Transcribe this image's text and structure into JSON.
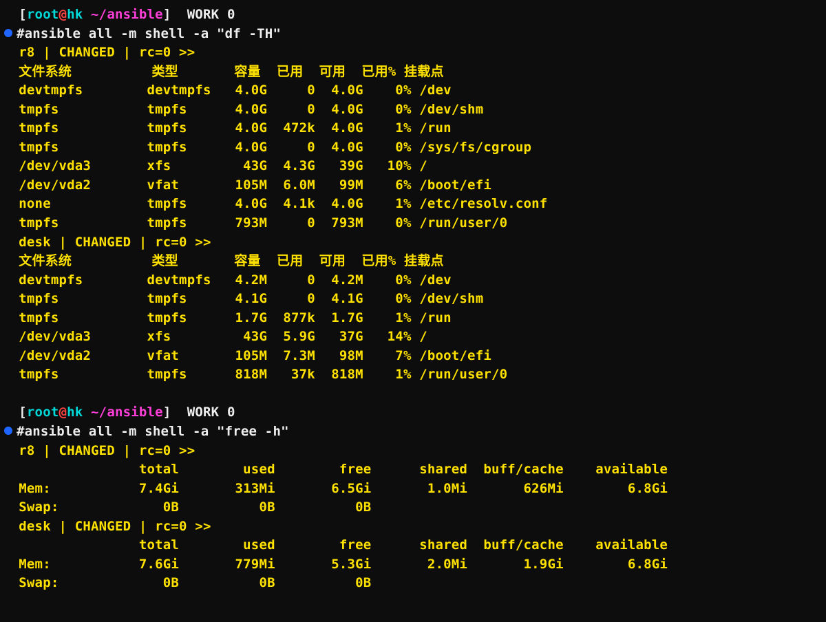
{
  "prompt": {
    "open_bracket": "[",
    "user": "root",
    "at": "@",
    "host": "hk",
    "space": " ",
    "path": "~/ansible",
    "close_bracket": "]",
    "label": "  WORK ",
    "num": "0"
  },
  "cmd1": "#ansible all -m shell -a \"df -TH\"",
  "status_r8": "r8 | CHANGED | rc=0 >>",
  "status_desk": "desk | CHANGED | rc=0 >>",
  "df_header": {
    "fs": "文件系统",
    "type": "类型",
    "size": "容量",
    "used": "已用",
    "avail": "可用",
    "usep": "已用%",
    "mount": "挂载点"
  },
  "df_r8": [
    {
      "fs": "devtmpfs",
      "type": "devtmpfs",
      "size": "4.0G",
      "used": "0",
      "avail": "4.0G",
      "usep": "0%",
      "mount": "/dev"
    },
    {
      "fs": "tmpfs",
      "type": "tmpfs",
      "size": "4.0G",
      "used": "0",
      "avail": "4.0G",
      "usep": "0%",
      "mount": "/dev/shm"
    },
    {
      "fs": "tmpfs",
      "type": "tmpfs",
      "size": "4.0G",
      "used": "472k",
      "avail": "4.0G",
      "usep": "1%",
      "mount": "/run"
    },
    {
      "fs": "tmpfs",
      "type": "tmpfs",
      "size": "4.0G",
      "used": "0",
      "avail": "4.0G",
      "usep": "0%",
      "mount": "/sys/fs/cgroup"
    },
    {
      "fs": "/dev/vda3",
      "type": "xfs",
      "size": "43G",
      "used": "4.3G",
      "avail": "39G",
      "usep": "10%",
      "mount": "/"
    },
    {
      "fs": "/dev/vda2",
      "type": "vfat",
      "size": "105M",
      "used": "6.0M",
      "avail": "99M",
      "usep": "6%",
      "mount": "/boot/efi"
    },
    {
      "fs": "none",
      "type": "tmpfs",
      "size": "4.0G",
      "used": "4.1k",
      "avail": "4.0G",
      "usep": "1%",
      "mount": "/etc/resolv.conf"
    },
    {
      "fs": "tmpfs",
      "type": "tmpfs",
      "size": "793M",
      "used": "0",
      "avail": "793M",
      "usep": "0%",
      "mount": "/run/user/0"
    }
  ],
  "df_desk": [
    {
      "fs": "devtmpfs",
      "type": "devtmpfs",
      "size": "4.2M",
      "used": "0",
      "avail": "4.2M",
      "usep": "0%",
      "mount": "/dev"
    },
    {
      "fs": "tmpfs",
      "type": "tmpfs",
      "size": "4.1G",
      "used": "0",
      "avail": "4.1G",
      "usep": "0%",
      "mount": "/dev/shm"
    },
    {
      "fs": "tmpfs",
      "type": "tmpfs",
      "size": "1.7G",
      "used": "877k",
      "avail": "1.7G",
      "usep": "1%",
      "mount": "/run"
    },
    {
      "fs": "/dev/vda3",
      "type": "xfs",
      "size": "43G",
      "used": "5.9G",
      "avail": "37G",
      "usep": "14%",
      "mount": "/"
    },
    {
      "fs": "/dev/vda2",
      "type": "vfat",
      "size": "105M",
      "used": "7.3M",
      "avail": "98M",
      "usep": "7%",
      "mount": "/boot/efi"
    },
    {
      "fs": "tmpfs",
      "type": "tmpfs",
      "size": "818M",
      "used": "37k",
      "avail": "818M",
      "usep": "1%",
      "mount": "/run/user/0"
    }
  ],
  "cmd2": "#ansible all -m shell -a \"free -h\"",
  "free_header": {
    "total": "total",
    "used": "used",
    "free": "free",
    "shared": "shared",
    "buff": "buff/cache",
    "avail": "available"
  },
  "free_r8": {
    "mem": {
      "label": "Mem:",
      "total": "7.4Gi",
      "used": "313Mi",
      "free": "6.5Gi",
      "shared": "1.0Mi",
      "buff": "626Mi",
      "avail": "6.8Gi"
    },
    "swap": {
      "label": "Swap:",
      "total": "0B",
      "used": "0B",
      "free": "0B"
    }
  },
  "free_desk": {
    "mem": {
      "label": "Mem:",
      "total": "7.6Gi",
      "used": "779Mi",
      "free": "5.3Gi",
      "shared": "2.0Mi",
      "buff": "1.9Gi",
      "avail": "6.8Gi"
    },
    "swap": {
      "label": "Swap:",
      "total": "0B",
      "used": "0B",
      "free": "0B"
    }
  }
}
